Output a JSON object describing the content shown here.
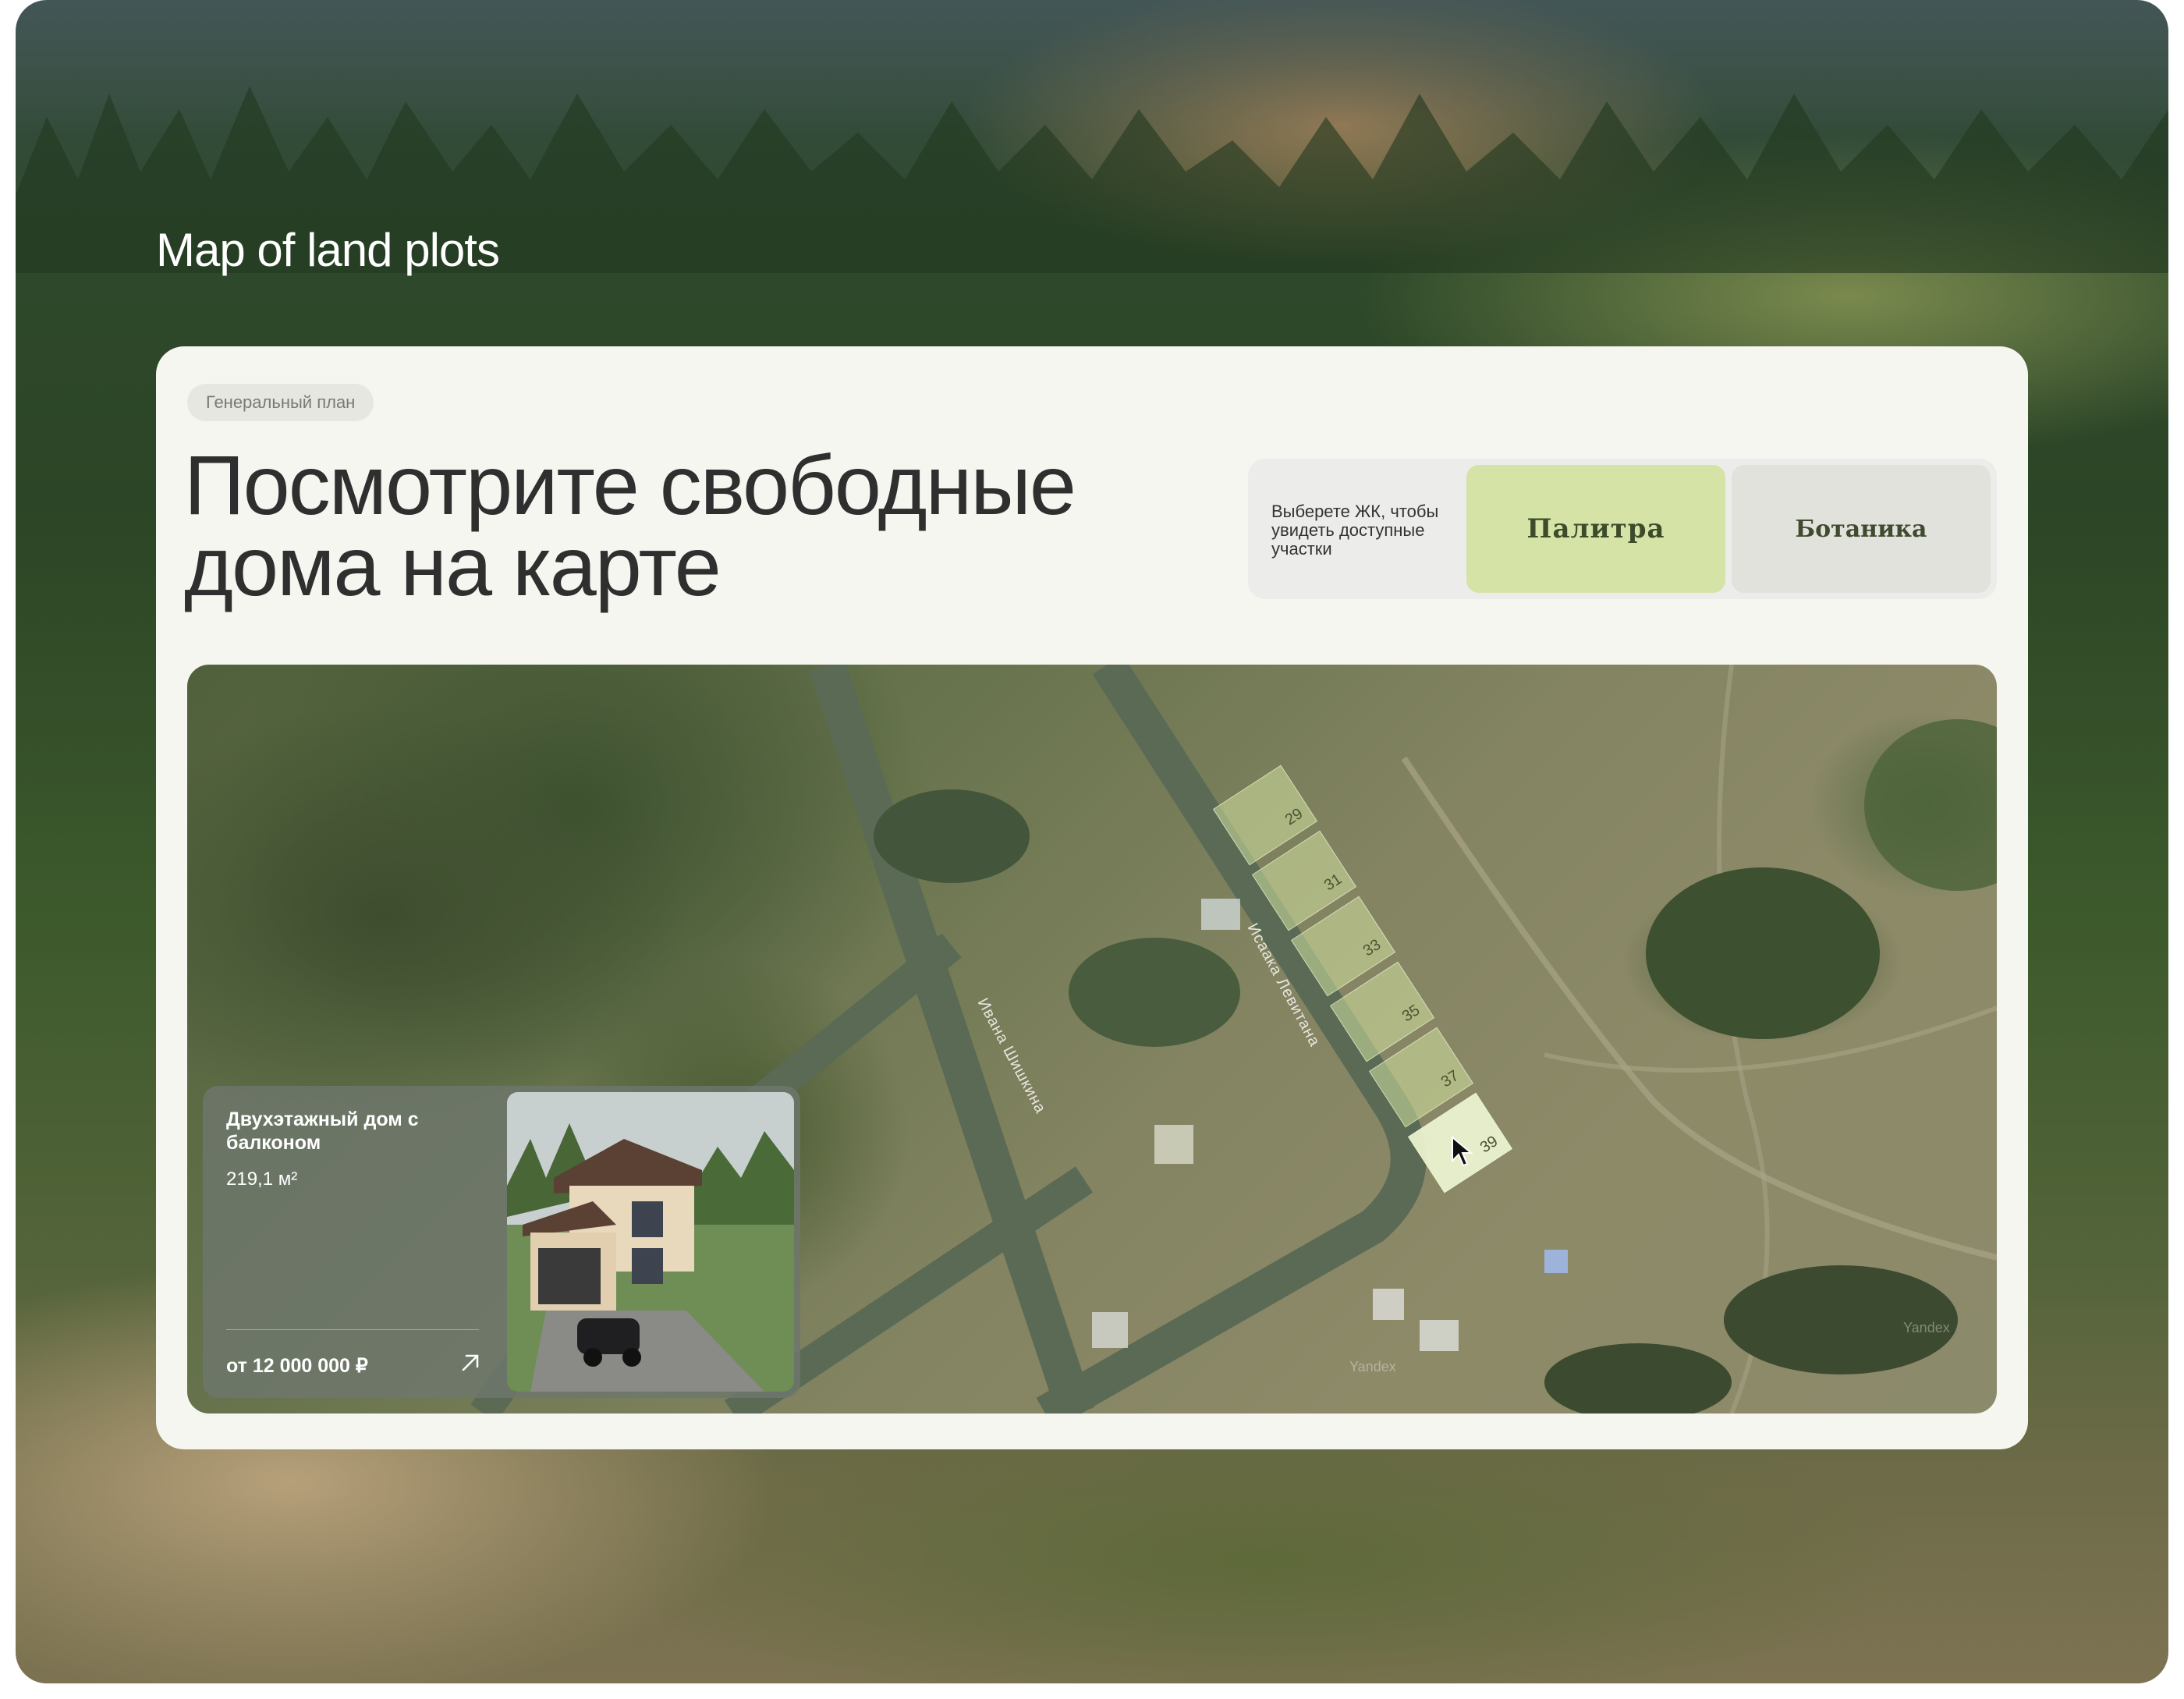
{
  "hero": {
    "title": "Map of land plots"
  },
  "card": {
    "tag": "Генеральный план",
    "headline_line1": "Посмотрите свободные",
    "headline_line2": "дома на карте"
  },
  "selector": {
    "hint": "Выберете ЖК, чтобы увидеть доступные участки",
    "options": [
      {
        "label": "Палитра",
        "selected": true
      },
      {
        "label": "Ботаника",
        "selected": false
      }
    ]
  },
  "map": {
    "streets": [
      "Ивана Шишкина",
      "Исаака Левитана"
    ],
    "watermark": "Yandex",
    "plots": [
      {
        "number": "29",
        "selected": false
      },
      {
        "number": "31",
        "selected": false
      },
      {
        "number": "33",
        "selected": false
      },
      {
        "number": "35",
        "selected": false
      },
      {
        "number": "37",
        "selected": false
      },
      {
        "number": "39",
        "selected": true
      }
    ]
  },
  "house": {
    "name": "Двухэтажный дом с балконом",
    "area": "219,1 м²",
    "price": "от 12 000 000 ₽"
  },
  "colors": {
    "card_bg": "#f6f6f1",
    "selected_option": "#d6e3a7",
    "plot_fill": "#d2e1a0",
    "text_dark": "#2f2f2f"
  }
}
